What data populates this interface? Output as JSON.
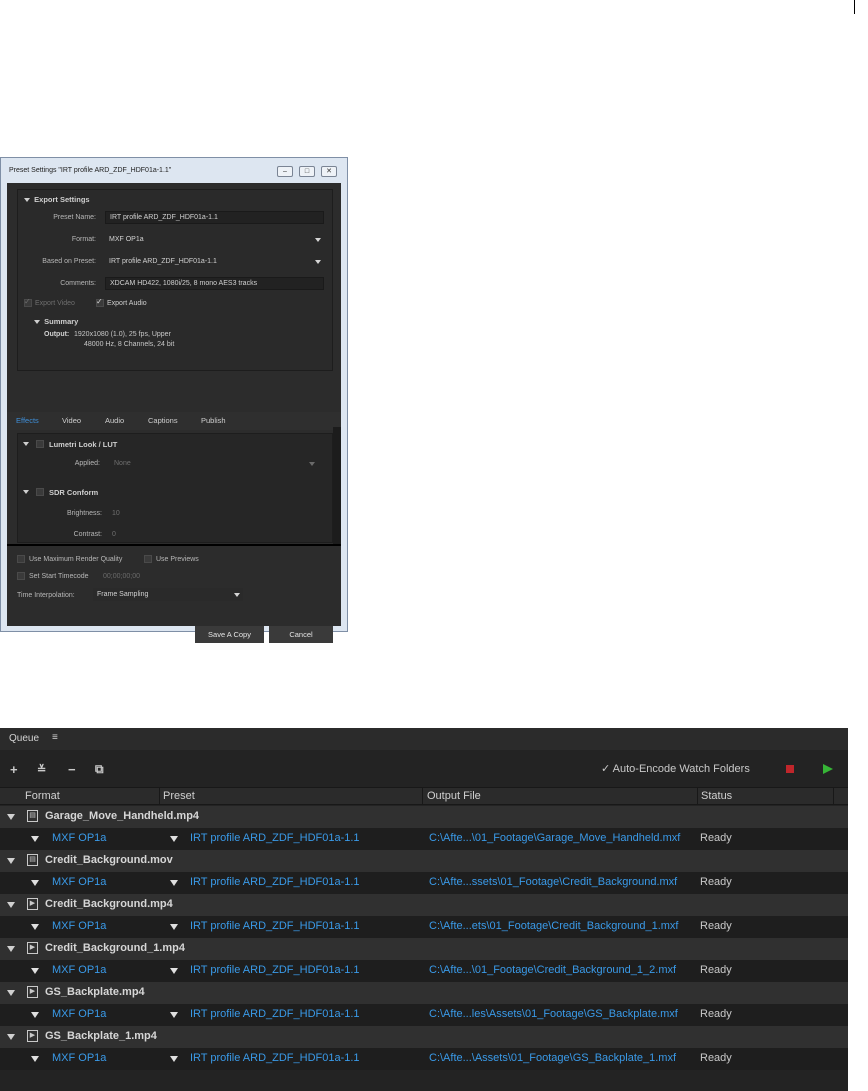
{
  "dialog": {
    "title": "Preset Settings \"IRT profile ARD_ZDF_HDF01a-1.1\"",
    "export_settings_header": "Export Settings",
    "preset_name_label": "Preset Name:",
    "preset_name_value": "IRT profile ARD_ZDF_HDF01a-1.1",
    "format_label": "Format:",
    "format_value": "MXF OP1a",
    "based_on_label": "Based on Preset:",
    "based_on_value": "IRT profile ARD_ZDF_HDF01a-1.1",
    "comments_label": "Comments:",
    "comments_value": "XDCAM HD422, 1080i/25, 8 mono AES3 tracks",
    "export_video_label": "Export Video",
    "export_audio_label": "Export Audio",
    "summary_header": "Summary",
    "output_label": "Output:",
    "output_line1": "1920x1080 (1.0), 25 fps, Upper",
    "output_line2": "48000 Hz, 8 Channels, 24 bit",
    "tabs": [
      "Effects",
      "Video",
      "Audio",
      "Captions",
      "Publish"
    ],
    "lumetri_header": "Lumetri Look / LUT",
    "applied_label": "Applied:",
    "applied_value": "None",
    "sdr_header": "SDR Conform",
    "brightness_label": "Brightness:",
    "brightness_value": "10",
    "contrast_label": "Contrast:",
    "contrast_value": "0",
    "max_render_label": "Use Maximum Render Quality",
    "use_previews_label": "Use Previews",
    "start_timecode_label": "Set Start Timecode",
    "start_timecode_value": "00;00;00;00",
    "time_interp_label": "Time Interpolation:",
    "time_interp_value": "Frame Sampling",
    "save_copy_label": "Save A Copy",
    "cancel_label": "Cancel"
  },
  "queue": {
    "title": "Queue",
    "menu_glyph": "≡",
    "auto_encode_label": "Auto-Encode Watch Folders",
    "columns": [
      "Format",
      "Preset",
      "Output File",
      "Status"
    ],
    "items": [
      {
        "name": "Garage_Move_Handheld.mp4",
        "type": "film",
        "format": "MXF OP1a",
        "preset": "IRT profile ARD_ZDF_HDF01a-1.1",
        "output": "C:\\Afte...\\01_Footage\\Garage_Move_Handheld.mxf",
        "status": "Ready"
      },
      {
        "name": "Credit_Background.mov",
        "type": "film",
        "format": "MXF OP1a",
        "preset": "IRT profile ARD_ZDF_HDF01a-1.1",
        "output": "C:\\Afte...ssets\\01_Footage\\Credit_Background.mxf",
        "status": "Ready"
      },
      {
        "name": "Credit_Background.mp4",
        "type": "clip",
        "format": "MXF OP1a",
        "preset": "IRT profile ARD_ZDF_HDF01a-1.1",
        "output": "C:\\Afte...ets\\01_Footage\\Credit_Background_1.mxf",
        "status": "Ready"
      },
      {
        "name": "Credit_Background_1.mp4",
        "type": "clip",
        "format": "MXF OP1a",
        "preset": "IRT profile ARD_ZDF_HDF01a-1.1",
        "output": "C:\\Afte...\\01_Footage\\Credit_Background_1_2.mxf",
        "status": "Ready"
      },
      {
        "name": "GS_Backplate.mp4",
        "type": "clip",
        "format": "MXF OP1a",
        "preset": "IRT profile ARD_ZDF_HDF01a-1.1",
        "output": "C:\\Afte...les\\Assets\\01_Footage\\GS_Backplate.mxf",
        "status": "Ready"
      },
      {
        "name": "GS_Backplate_1.mp4",
        "type": "clip",
        "format": "MXF OP1a",
        "preset": "IRT profile ARD_ZDF_HDF01a-1.1",
        "output": "C:\\Afte...\\Assets\\01_Footage\\GS_Backplate_1.mxf",
        "status": "Ready"
      }
    ]
  }
}
